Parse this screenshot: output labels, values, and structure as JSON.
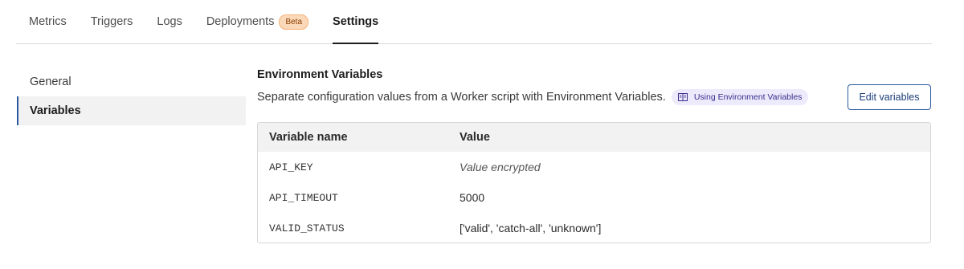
{
  "tabs": [
    {
      "label": "Metrics"
    },
    {
      "label": "Triggers"
    },
    {
      "label": "Logs"
    },
    {
      "label": "Deployments",
      "badge": "Beta"
    },
    {
      "label": "Settings",
      "active": true
    }
  ],
  "sidebar": {
    "items": [
      {
        "label": "General"
      },
      {
        "label": "Variables",
        "active": true
      }
    ]
  },
  "section": {
    "title": "Environment Variables",
    "description": "Separate configuration values from a Worker script with Environment Variables.",
    "doc_link": {
      "label": "Using Environment Variables",
      "icon": "book-icon"
    },
    "edit_button": "Edit variables"
  },
  "table": {
    "headers": {
      "name": "Variable name",
      "value": "Value"
    },
    "rows": [
      {
        "name": "API_KEY",
        "value": "Value encrypted",
        "encrypted": true
      },
      {
        "name": "API_TIMEOUT",
        "value": "5000"
      },
      {
        "name": "VALID_STATUS",
        "value": "['valid', 'catch-all', 'unknown']"
      }
    ]
  },
  "colors": {
    "accent": "#2c5aa0",
    "badge_bg": "#fbd9b8",
    "link_bg": "#eceafb"
  }
}
